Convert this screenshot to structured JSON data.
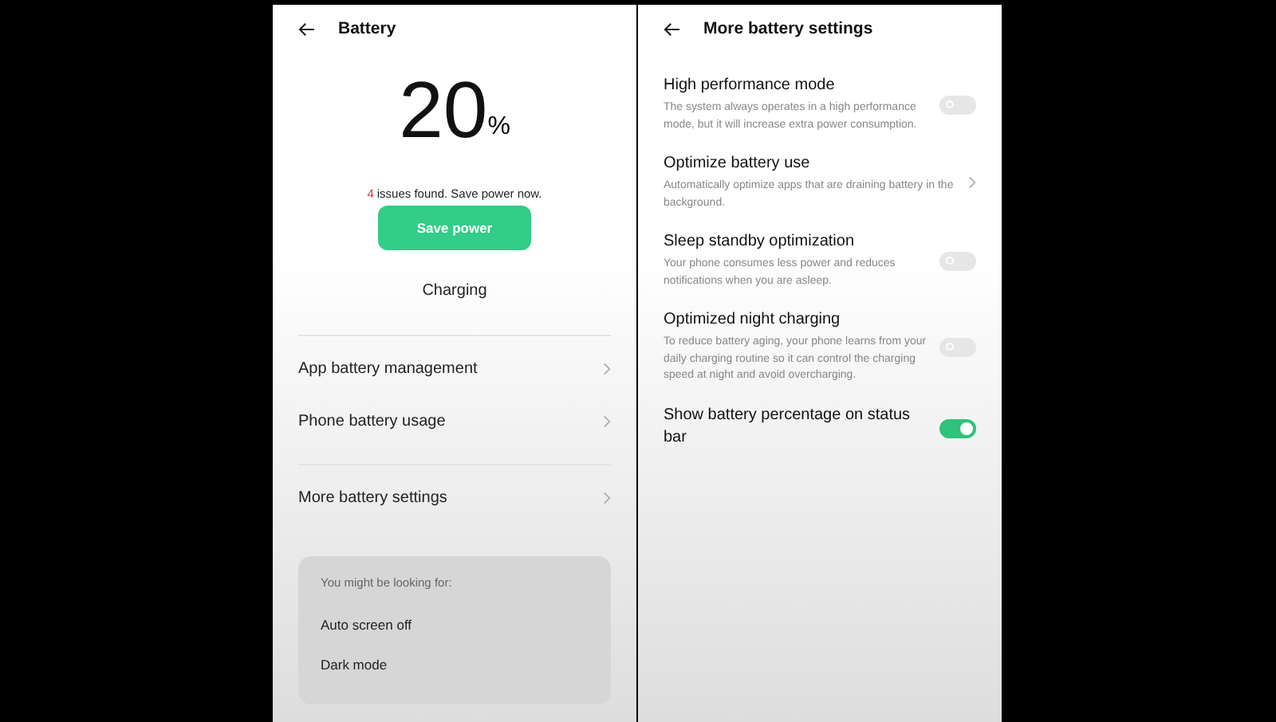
{
  "left": {
    "title": "Battery",
    "percent": "20",
    "percent_sign": "%",
    "issue_count": "4",
    "issue_text": "issues found. Save power now.",
    "save_button": "Save power",
    "status": "Charging",
    "groups": [
      [
        {
          "label": "App battery management"
        },
        {
          "label": "Phone battery usage"
        }
      ],
      [
        {
          "label": "More battery settings"
        }
      ]
    ],
    "suggestions": {
      "heading": "You might be looking for:",
      "items": [
        "Auto screen off",
        "Dark mode"
      ]
    }
  },
  "right": {
    "title": "More battery settings",
    "items": [
      {
        "kind": "toggle",
        "title": "High performance mode",
        "description": "The system always operates in a high performance mode, but it will increase extra power consumption.",
        "on": false
      },
      {
        "kind": "link",
        "title": "Optimize battery use",
        "description": "Automatically optimize apps that are draining battery in the background."
      },
      {
        "kind": "toggle",
        "title": "Sleep standby optimization",
        "description": "Your phone consumes less power and reduces notifications when you are asleep.",
        "on": false
      },
      {
        "kind": "toggle",
        "title": "Optimized night charging",
        "description": "To reduce battery aging, your phone learns from your daily charging routine so it can control the charging speed at night and avoid overcharging.",
        "on": false
      },
      {
        "kind": "toggle",
        "title": "Show battery percentage on status bar",
        "on": true
      }
    ]
  }
}
